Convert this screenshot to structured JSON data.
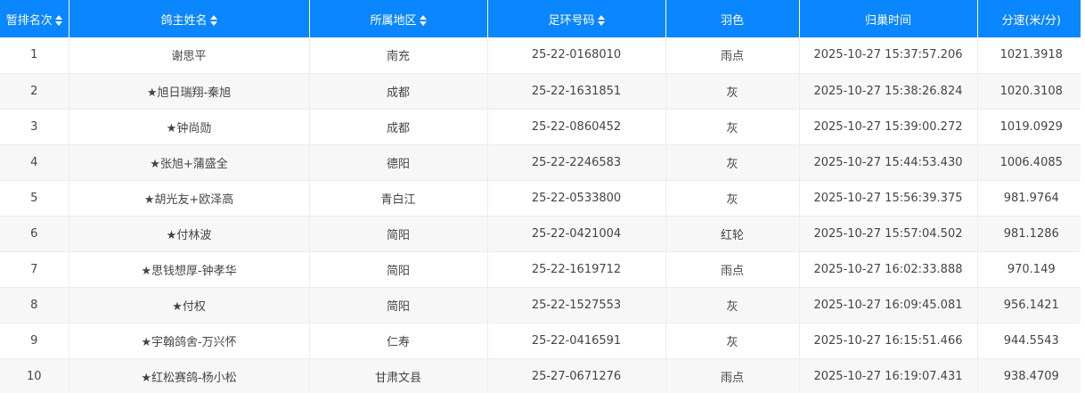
{
  "table": {
    "columns": [
      {
        "label": "暂排名次",
        "sortable": true
      },
      {
        "label": "鸽主姓名",
        "sortable": true
      },
      {
        "label": "所属地区",
        "sortable": true
      },
      {
        "label": "足环号码",
        "sortable": true
      },
      {
        "label": "羽色",
        "sortable": false
      },
      {
        "label": "归巢时间",
        "sortable": false
      },
      {
        "label": "分速(米/分)",
        "sortable": false
      }
    ],
    "rows": [
      [
        "1",
        "谢思平",
        "南充",
        "25-22-0168010",
        "雨点",
        "2025-10-27 15:37:57.206",
        "1021.3918"
      ],
      [
        "2",
        "★旭日瑞翔-秦旭",
        "成都",
        "25-22-1631851",
        "灰",
        "2025-10-27 15:38:26.824",
        "1020.3108"
      ],
      [
        "3",
        "★钟尚勋",
        "成都",
        "25-22-0860452",
        "灰",
        "2025-10-27 15:39:00.272",
        "1019.0929"
      ],
      [
        "4",
        "★张旭+蒲盛全",
        "德阳",
        "25-22-2246583",
        "灰",
        "2025-10-27 15:44:53.430",
        "1006.4085"
      ],
      [
        "5",
        "★胡光友+欧泽高",
        "青白江",
        "25-22-0533800",
        "灰",
        "2025-10-27 15:56:39.375",
        "981.9764"
      ],
      [
        "6",
        "★付林波",
        "简阳",
        "25-22-0421004",
        "红轮",
        "2025-10-27 15:57:04.502",
        "981.1286"
      ],
      [
        "7",
        "★思钱想厚-钟孝华",
        "简阳",
        "25-22-1619712",
        "雨点",
        "2025-10-27 16:02:33.888",
        "970.149"
      ],
      [
        "8",
        "★付权",
        "简阳",
        "25-22-1527553",
        "灰",
        "2025-10-27 16:09:45.081",
        "956.1421"
      ],
      [
        "9",
        "★宇翰鸽舍-万兴怀",
        "仁寿",
        "25-22-0416591",
        "灰",
        "2025-10-27 16:15:51.466",
        "944.5543"
      ],
      [
        "10",
        "★红松赛鸽-杨小松",
        "甘肃文县",
        "25-27-0671276",
        "雨点",
        "2025-10-27 16:19:07.431",
        "938.4709"
      ]
    ]
  },
  "colors": {
    "header_bg": "#0a86ff",
    "header_text": "#ffffff",
    "row_alt_bg": "#f7f7f7",
    "cell_text": "#444444"
  },
  "icons": {
    "sort": "sort-icon"
  }
}
